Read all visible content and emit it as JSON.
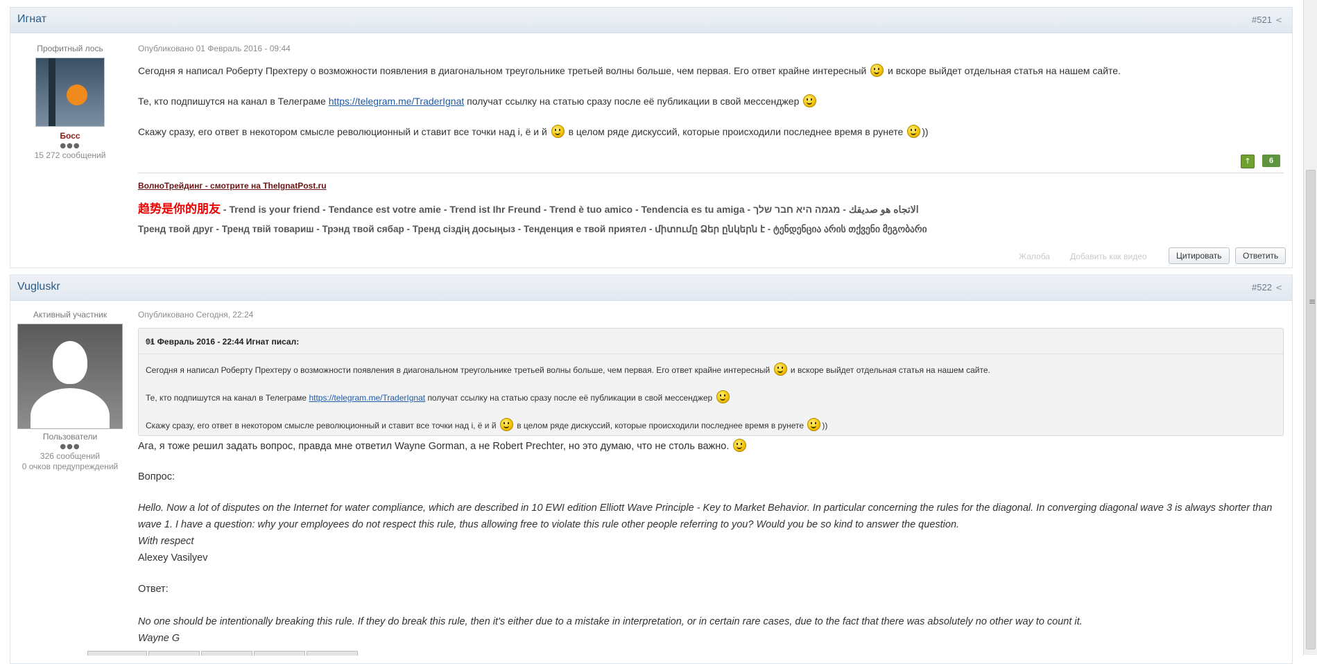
{
  "posts": [
    {
      "author": "Игнат",
      "number": "#521",
      "user_title": "Профитный лось",
      "rank": "Босс",
      "pips": "●●●",
      "msg_count": "15 272 сообщений",
      "published": "Опубликовано 01 Февраль 2016 - 09:44",
      "para1_a": "Сегодня я написал Роберту Прехтеру о возможности появления в диагональном треугольнике третьей волны больше, чем первая. Его ответ крайне интересный",
      "para1_b": "и вскоре выйдет отдельная статья на нашем сайте.",
      "para2_a": "Те, кто подпишутся на канал в Телеграме",
      "para2_link": "https://telegram.me/TraderIgnat",
      "para2_b": "получат ссылку на статью сразу после её публикации в свой мессенджер",
      "para3_a": "Скажу сразу, его ответ в некотором смысле революционный и ставит все точки над i, ё и й",
      "para3_b": "в целом ряде дискуссий, которые происходили последнее время в рунете",
      "para3_c": "))",
      "rep": "6",
      "signature": {
        "title": "ВолноТрейдинг - смотрите на TheIgnatPost.ru",
        "cn": "趋势是你的朋友",
        "line1": " -  Trend is your friend - Tendance est votre amie - Trend ist Ihr Freund - Trend è tuo amico - Tendencia es tu amiga -  الاتجاه هو صديقك  -  מגמה היא חבר שלך",
        "line2": "Тренд твой друг - Тренд твій товариш - Трэнд твой сябар - Тренд сіздің досыңыз - Тенденция е твой приятел - միտումը Ձեր ընկերն է - ტენდენცია არის თქვენი მეგობარი"
      },
      "report": "Жалоба",
      "add_video": "Добавить как видео",
      "quote_btn": "Цитировать",
      "reply_btn": "Ответить"
    },
    {
      "author": "Vugluskr",
      "number": "#522",
      "user_title": "Активный участник",
      "group": "Пользователи",
      "pips": "●●●",
      "msg_count": "326 сообщений",
      "warn": "0 очков предупреждений",
      "published": "Опубликовано Сегодня, 22:24",
      "quote_header": "01 Февраль 2016 - 22:44 Игнат писал:",
      "q1_a": "Сегодня я написал Роберту Прехтеру о возможности появления в диагональном треугольнике третьей волны больше, чем первая. Его ответ крайне интересный",
      "q1_b": "и вскоре выйдет отдельная статья на нашем сайте.",
      "q2_a": "Те, кто подпишутся на канал в Телеграме",
      "q2_link": "https://telegram.me/TraderIgnat",
      "q2_b": "получат ссылку на статью сразу после её публикации в свой мессенджер",
      "q3_a": "Скажу сразу, его ответ в некотором смысле революционный и ставит все точки над i, ё и й",
      "q3_b": "в целом ряде дискуссий, которые происходили последнее время в рунете",
      "q3_c": "))",
      "body1": "Ага, я тоже решил задать вопрос, правда мне ответил Wayne Gorman, а не Robert Prechter, но это думаю, что не столь важно.",
      "question_label": "Вопрос:",
      "question": "Hello. Now a lot of disputes on the Internet for water compliance, which are described in 10 EWI edition Elliott Wave Principle - Key to Market Behavior. In particular concerning the rules for the diagonal. In converging diagonal wave 3 is always shorter than wave 1. I have a question: why your employees do not respect this rule, thus allowing free to violate this rule other people referring to you? Would you be so kind to answer the question.",
      "with_respect": "With respect",
      "signed": "Alexey Vasilyev",
      "answer_label": "Ответ:",
      "answer": "No one should be intentionally breaking this rule. If they do break this rule, then it's either due to a mistake in interpretation, or in certain rare cases, due to the fact that there was absolutely no other way to count it.",
      "answer_sign": "Wayne G"
    }
  ]
}
